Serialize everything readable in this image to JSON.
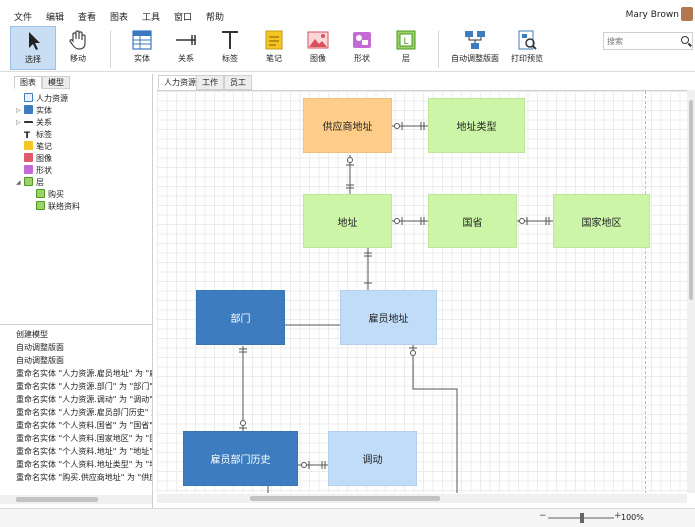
{
  "menu": [
    "文件",
    "编辑",
    "查看",
    "图表",
    "工具",
    "窗口",
    "帮助"
  ],
  "user": {
    "name": "Mary Brown"
  },
  "toolbar": {
    "tools": [
      {
        "label": "选择",
        "icon": "cursor-arrow-icon"
      },
      {
        "label": "移动",
        "icon": "hand-icon"
      },
      {
        "label": "实体",
        "icon": "entity-table-icon"
      },
      {
        "label": "关系",
        "icon": "relationship-line-icon"
      },
      {
        "label": "标签",
        "icon": "label-t-icon"
      },
      {
        "label": "笔记",
        "icon": "note-icon"
      },
      {
        "label": "图像",
        "icon": "image-icon"
      },
      {
        "label": "形状",
        "icon": "shape-icon"
      },
      {
        "label": "层",
        "icon": "layer-icon"
      },
      {
        "label": "自动调整版面",
        "icon": "auto-layout-icon"
      },
      {
        "label": "打印预览",
        "icon": "print-preview-icon"
      }
    ],
    "search_placeholder": "搜索"
  },
  "left_panel": {
    "tabs": [
      "图表",
      "模型"
    ],
    "tree": [
      "人力资源",
      "实体",
      "关系",
      "标签",
      "笔记",
      "图像",
      "形状",
      "层",
      "购买",
      "联络资料"
    ],
    "history": [
      "创建模型",
      "自动调整版面",
      "自动调整版面",
      "重命名实体 \"人力资源.雇员地址\" 为 \"雇员",
      "重命名实体 \"人力资源.部门\" 为 \"部门\"",
      "重命名实体 \"人力资源.调动\" 为 \"调动\"",
      "重命名实体 \"人力资源.雇员部门历史\" 为 \"",
      "重命名实体 \"个人资料.国省\" 为 \"国省\"",
      "重命名实体 \"个人资料.国家地区\" 为 \"国家",
      "重命名实体 \"个人资料.地址\" 为 \"地址\"",
      "重命名实体 \"个人资料.地址类型\" 为 \"地址",
      "重命名实体 \"购买.供应商地址\" 为 \"供应商"
    ]
  },
  "canvas": {
    "tabs": [
      "人力资源",
      "工作",
      "员工"
    ],
    "entities": [
      {
        "name": "供应商地址",
        "color": "#ffcc8a"
      },
      {
        "name": "地址类型",
        "color": "#cdf5a8"
      },
      {
        "name": "地址",
        "color": "#cdf5a8"
      },
      {
        "name": "国省",
        "color": "#cdf5a8"
      },
      {
        "name": "国家地区",
        "color": "#cdf5a8"
      },
      {
        "name": "部门",
        "color": "#3d7dbf"
      },
      {
        "name": "雇员地址",
        "color": "#c0dcf8"
      },
      {
        "name": "雇员部门历史",
        "color": "#3d7dbf"
      },
      {
        "name": "调动",
        "color": "#c0dcf8"
      }
    ]
  },
  "status": {
    "zoom": "100%"
  }
}
